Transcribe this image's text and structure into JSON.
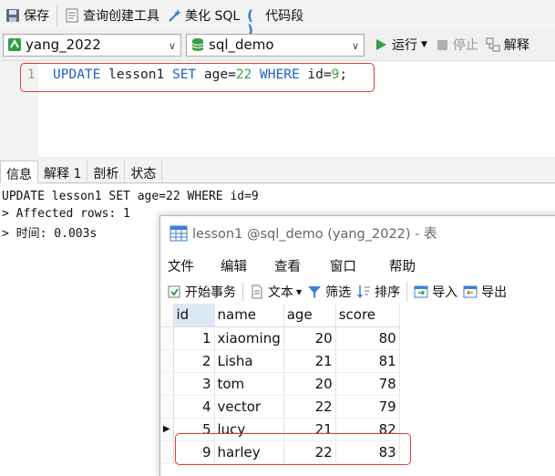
{
  "toolbar": {
    "save": "保存",
    "query_builder": "查询创建工具",
    "beautify_sql": "美化 SQL",
    "code_snippet": "代码段"
  },
  "connection": {
    "server": "yang_2022",
    "database": "sql_demo",
    "run": "运行",
    "stop": "停止",
    "explain": "解释"
  },
  "editor": {
    "line_number": "1",
    "tokens": [
      "UPDATE",
      " lesson1 ",
      "SET",
      " age=",
      "22",
      " ",
      "WHERE",
      " id=",
      "9",
      ";"
    ]
  },
  "result_tabs": [
    "信息",
    "解释 1",
    "剖析",
    "状态"
  ],
  "messages": [
    "UPDATE lesson1 SET age=22 WHERE id=9",
    "> Affected rows: 1",
    "> 时间: 0.003s"
  ],
  "table_window": {
    "title": "lesson1 @sql_demo (yang_2022) - 表",
    "menu": [
      "文件",
      "编辑",
      "查看",
      "窗口",
      "帮助"
    ],
    "tools": {
      "begin_transaction": "开始事务",
      "text": "文本",
      "filter": "筛选",
      "sort": "排序",
      "import": "导入",
      "export": "导出"
    },
    "columns": [
      "id",
      "name",
      "age",
      "score"
    ],
    "rows": [
      {
        "id": "1",
        "name": "xiaoming",
        "age": "20",
        "score": "80"
      },
      {
        "id": "2",
        "name": "Lisha",
        "age": "21",
        "score": "81"
      },
      {
        "id": "3",
        "name": "tom",
        "age": "20",
        "score": "78"
      },
      {
        "id": "4",
        "name": "vector",
        "age": "22",
        "score": "79"
      },
      {
        "id": "5",
        "name": "lucy",
        "age": "21",
        "score": "82"
      },
      {
        "id": "9",
        "name": "harley",
        "age": "22",
        "score": "83"
      }
    ]
  },
  "colors": {
    "keyword": "#1f62c9",
    "number": "#3aa046",
    "highlight_box": "#e03a3a",
    "run_icon": "#2ea043"
  }
}
